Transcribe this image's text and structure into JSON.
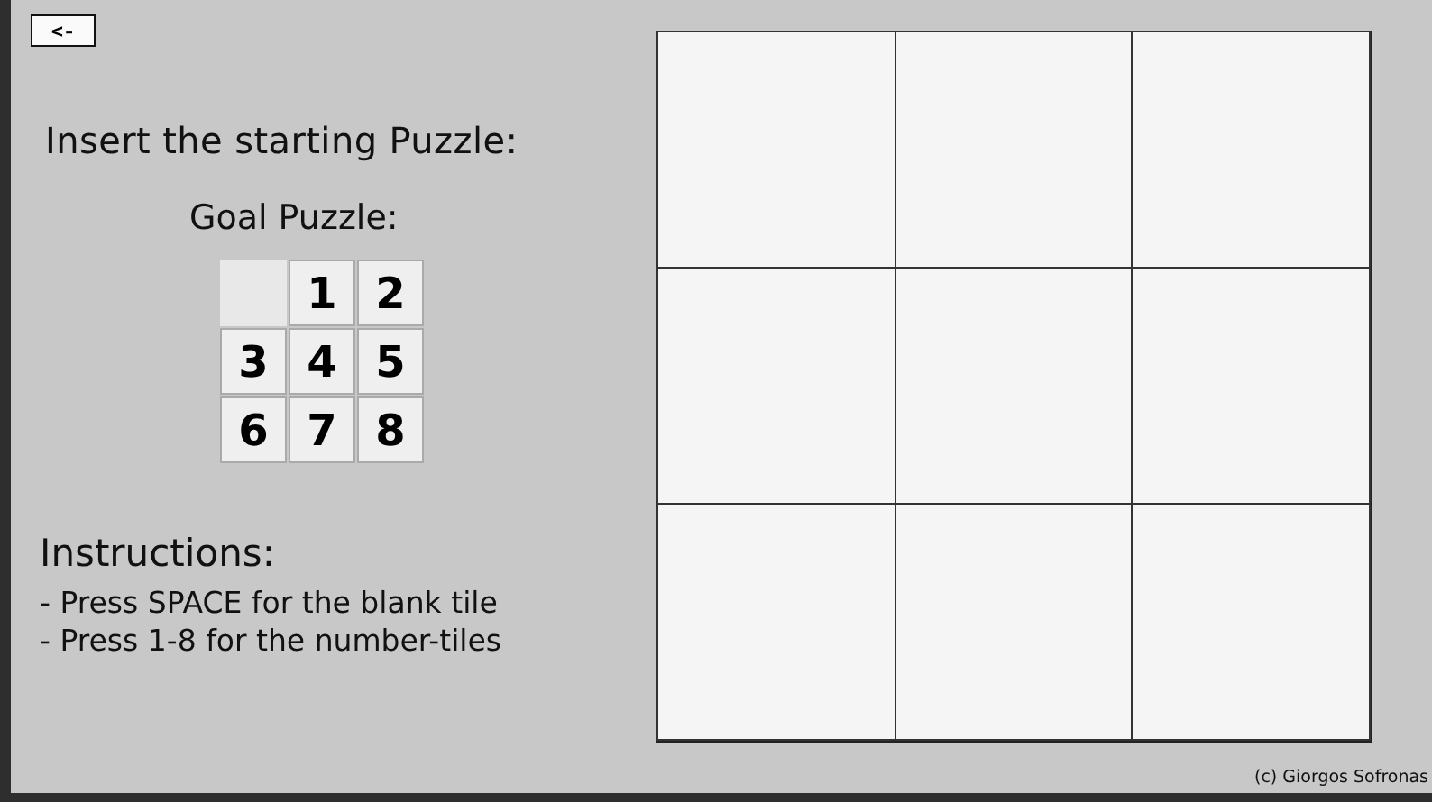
{
  "back_button": {
    "label": "<-"
  },
  "heading": "Insert the starting Puzzle:",
  "goal_puzzle": {
    "title": "Goal Puzzle:",
    "tiles": [
      {
        "kind": "blank"
      },
      {
        "kind": "number",
        "label": "1"
      },
      {
        "kind": "number",
        "label": "2"
      },
      {
        "kind": "number",
        "label": "3"
      },
      {
        "kind": "number",
        "label": "4"
      },
      {
        "kind": "number",
        "label": "5"
      },
      {
        "kind": "number",
        "label": "6"
      },
      {
        "kind": "number",
        "label": "7"
      },
      {
        "kind": "number",
        "label": "8"
      }
    ]
  },
  "instructions": {
    "title": "Instructions:",
    "lines": [
      "- Press SPACE for the blank tile",
      "- Press 1-8 for the number-tiles"
    ]
  },
  "footer": "(c) Giorgos Sofronas"
}
